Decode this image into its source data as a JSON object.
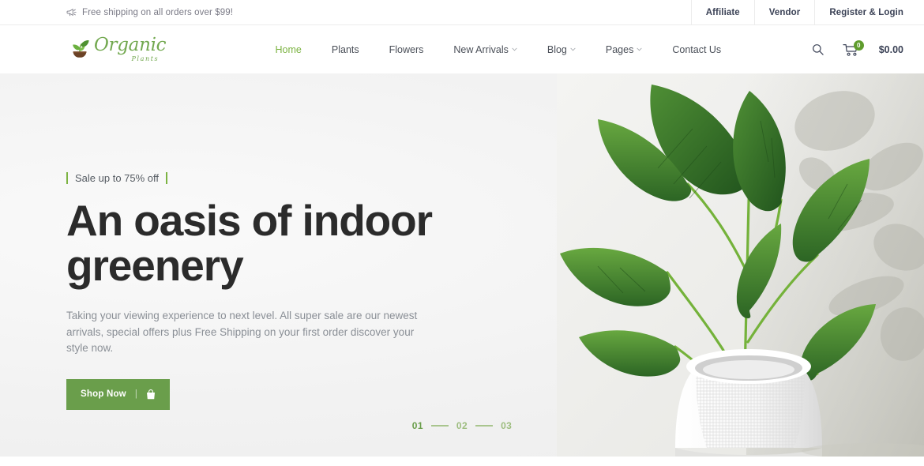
{
  "topbar": {
    "announcement": "Free shipping on all orders over $99!",
    "megaphone_icon": "megaphone-icon",
    "links": [
      {
        "label": "Affiliate"
      },
      {
        "label": "Vendor"
      },
      {
        "label": "Register & Login"
      }
    ]
  },
  "header": {
    "logo": {
      "name": "Organic",
      "subtitle": "Plants",
      "icon": "seedling-in-pot-icon"
    },
    "nav": [
      {
        "label": "Home",
        "active": true,
        "dropdown": false
      },
      {
        "label": "Plants",
        "active": false,
        "dropdown": false
      },
      {
        "label": "Flowers",
        "active": false,
        "dropdown": false
      },
      {
        "label": "New Arrivals",
        "active": false,
        "dropdown": true
      },
      {
        "label": "Blog",
        "active": false,
        "dropdown": true
      },
      {
        "label": "Pages",
        "active": false,
        "dropdown": true
      },
      {
        "label": "Contact Us",
        "active": false,
        "dropdown": false
      }
    ],
    "search_icon": "search-icon",
    "cart": {
      "icon": "shopping-cart-icon",
      "count": "0",
      "total": "$0.00"
    }
  },
  "hero": {
    "eyebrow": "Sale up to 75% off",
    "headline_line1": "An oasis of indoor",
    "headline_line2": "greenery",
    "subtext": "Taking your viewing experience to next level. All super sale are our newest arrivals, special offers plus Free Shipping on your first order discover your style now.",
    "cta": {
      "label": "Shop Now",
      "separator": "|",
      "icon": "shopping-bag-icon"
    },
    "image_alt": "monstera-plant-in-white-textured-pot"
  },
  "pager": {
    "slides": [
      {
        "label": "01",
        "active": true
      },
      {
        "label": "02",
        "active": false
      },
      {
        "label": "03",
        "active": false
      }
    ]
  },
  "colors": {
    "accent_green": "#7cb342",
    "button_green": "#6a9e4b",
    "logo_green": "#72a84f",
    "dark_navy": "#3b4256",
    "heading_dark": "#2b2b2b",
    "body_gray": "#8a8f96",
    "hero_bg": "#f0f0f0"
  }
}
